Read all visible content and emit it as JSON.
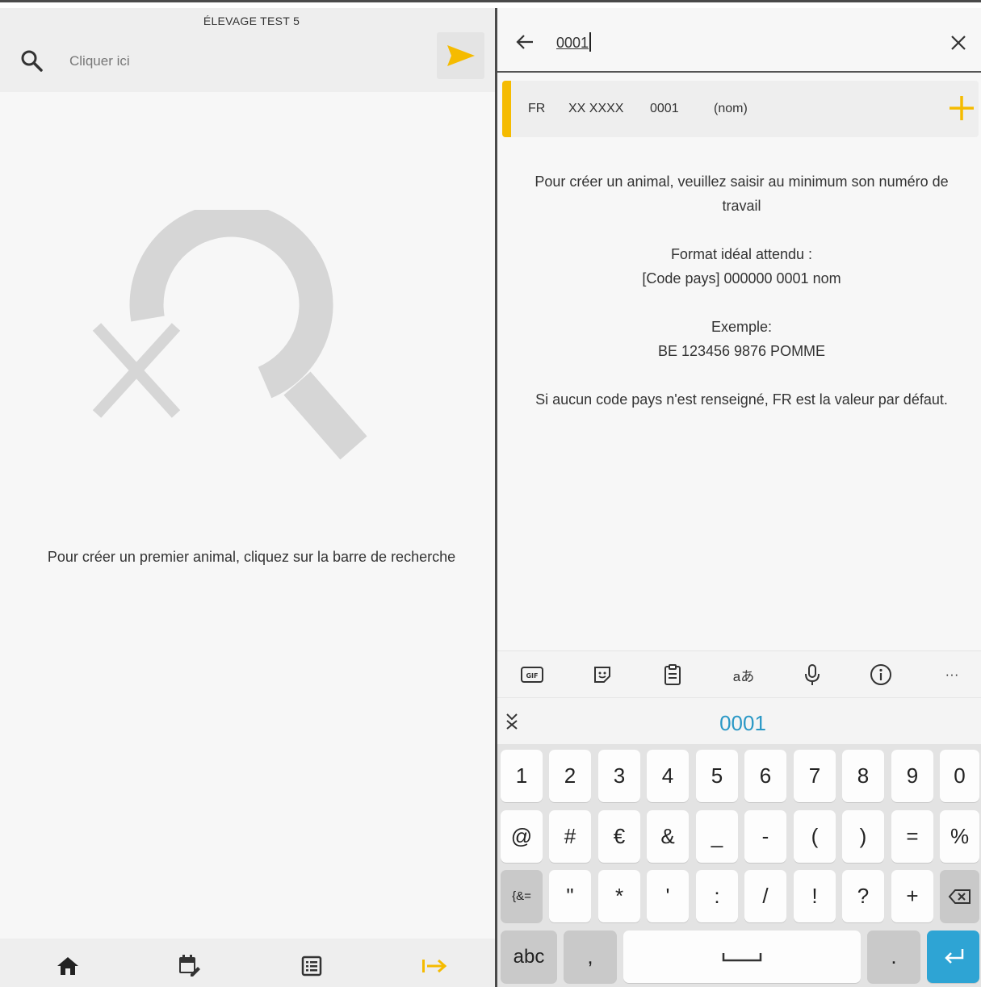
{
  "left": {
    "farm_name": "ÉLEVAGE TEST 5",
    "search_placeholder": "Cliquer ici",
    "empty_message": "Pour créer un premier animal, cliquez sur la barre de recherche",
    "nav": [
      {
        "icon": "home-icon"
      },
      {
        "icon": "calendar-edit-icon"
      },
      {
        "icon": "list-icon"
      },
      {
        "icon": "logout-icon"
      }
    ]
  },
  "right": {
    "search_value": "0001",
    "suggestion": {
      "country": "FR",
      "code": "XX XXXX",
      "number": "0001",
      "name": "(nom)"
    },
    "help": {
      "line1": "Pour créer un animal, veuillez saisir au minimum son numéro de travail",
      "line2a": "Format idéal attendu :",
      "line2b": "[Code pays] 000000 0001 nom",
      "line3a": "Exemple:",
      "line3b": "BE 123456 9876 POMME",
      "line4": "Si aucun code pays n'est renseigné, FR est la valeur par défaut."
    }
  },
  "keyboard": {
    "toolbar": {
      "gif": "GIF",
      "translate": "aあ",
      "more": "···"
    },
    "suggestion": "0001",
    "row1": [
      "1",
      "2",
      "3",
      "4",
      "5",
      "6",
      "7",
      "8",
      "9",
      "0"
    ],
    "row2": [
      "@",
      "#",
      "€",
      "&",
      "_",
      "-",
      "(",
      ")",
      "=",
      "%"
    ],
    "row3": [
      "{&=",
      "\"",
      "*",
      "'",
      ":",
      "/",
      "!",
      "?",
      "+"
    ],
    "row4": {
      "abc": "abc",
      "comma": ",",
      "period": "."
    }
  },
  "colors": {
    "accent": "#f5bb00",
    "suggest_blue": "#2a98c6",
    "enter_blue": "#2ea4d4"
  }
}
